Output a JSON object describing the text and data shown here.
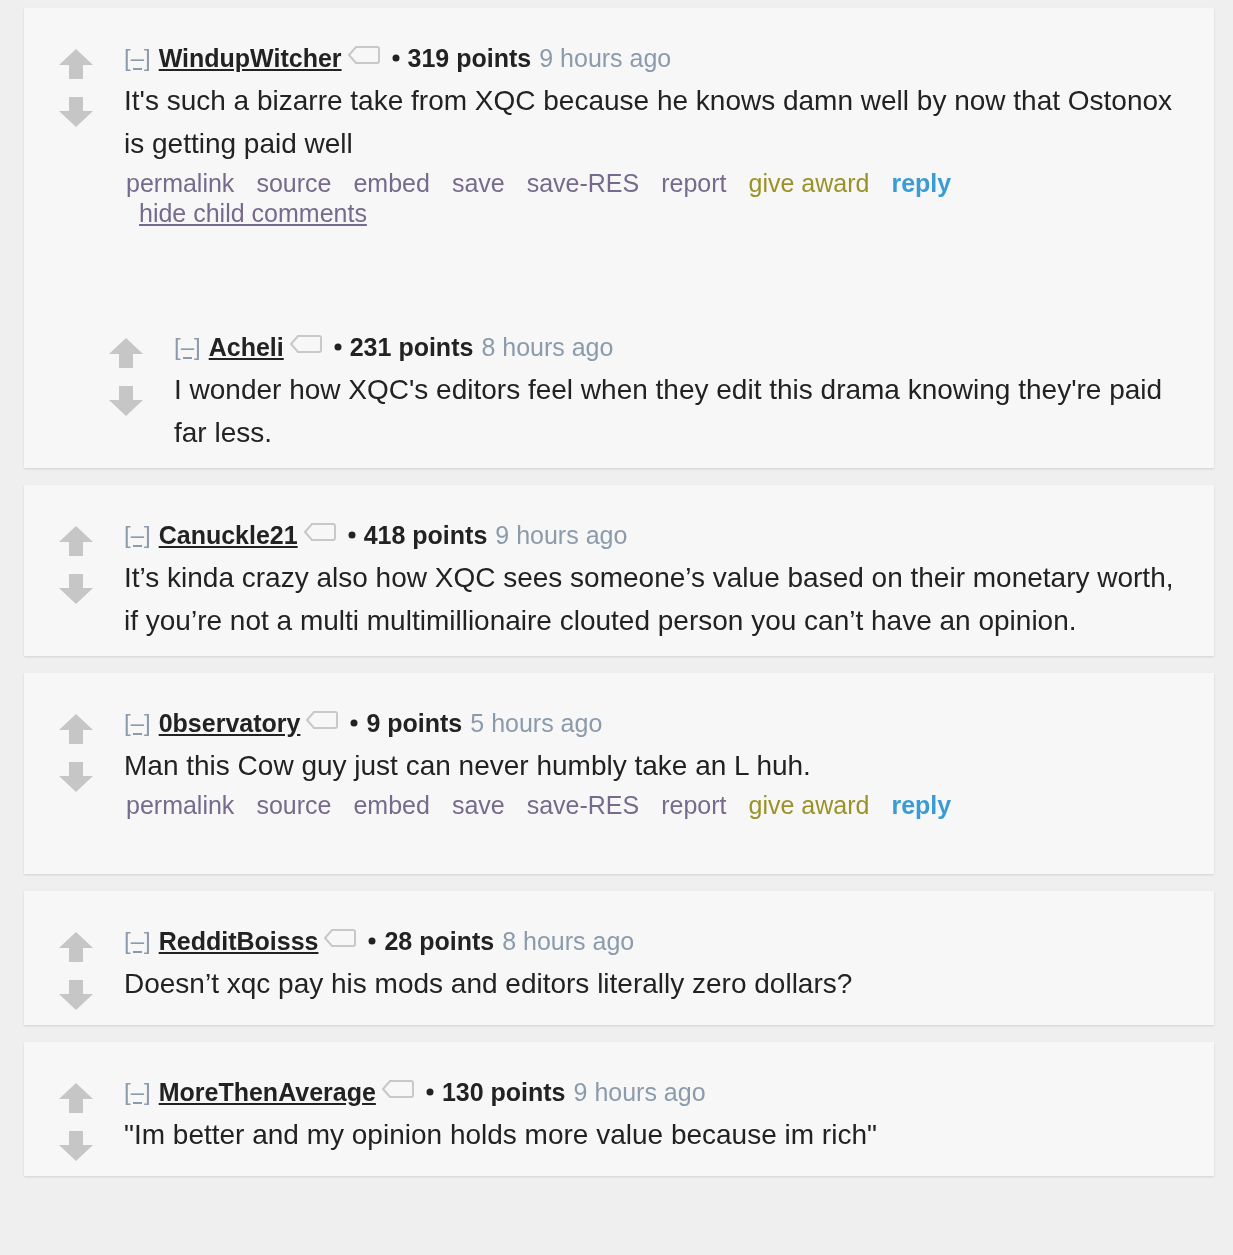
{
  "comments": [
    {
      "collapse": "[–]",
      "author": "WindupWitcher",
      "points": "319 points",
      "time": "9 hours ago",
      "body": "It's such a bizarre take from XQC because he knows damn well by now that Ostonox is getting paid well",
      "actions": [
        {
          "label": "permalink",
          "kind": "link"
        },
        {
          "label": "source",
          "kind": "link"
        },
        {
          "label": "embed",
          "kind": "link"
        },
        {
          "label": "save",
          "kind": "link"
        },
        {
          "label": "save-RES",
          "kind": "link"
        },
        {
          "label": "report",
          "kind": "link"
        },
        {
          "label": "give award",
          "kind": "award"
        },
        {
          "label": "reply",
          "kind": "reply"
        }
      ],
      "hide_link": "hide child comments",
      "children": [
        {
          "collapse": "[–]",
          "author": "Acheli",
          "points": "231 points",
          "time": "8 hours ago",
          "body": "I wonder how XQC's editors feel when they edit this drama knowing they're paid far less."
        }
      ]
    },
    {
      "collapse": "[–]",
      "author": "Canuckle21",
      "points": "418 points",
      "time": "9 hours ago",
      "body": "It’s kinda crazy also how XQC sees someone’s value based on their monetary worth, if you’re not a multi multimillionaire clouted person you can’t have an opinion."
    },
    {
      "collapse": "[–]",
      "author": "0bservatory",
      "points": "9 points",
      "time": "5 hours ago",
      "body": "Man this Cow guy just can never humbly take an L huh.",
      "actions": [
        {
          "label": "permalink",
          "kind": "link"
        },
        {
          "label": "source",
          "kind": "link"
        },
        {
          "label": "embed",
          "kind": "link"
        },
        {
          "label": "save",
          "kind": "link"
        },
        {
          "label": "save-RES",
          "kind": "link"
        },
        {
          "label": "report",
          "kind": "link"
        },
        {
          "label": "give award",
          "kind": "award"
        },
        {
          "label": "reply",
          "kind": "reply"
        }
      ]
    },
    {
      "collapse": "[–]",
      "author": "RedditBoisss",
      "points": "28 points",
      "time": "8 hours ago",
      "body": "Doesn’t xqc pay his mods and editors literally zero dollars?"
    },
    {
      "collapse": "[–]",
      "author": "MoreThenAverage",
      "points": "130 points",
      "time": "9 hours ago",
      "body": "\"Im better and my opinion holds more value because im rich\""
    }
  ]
}
